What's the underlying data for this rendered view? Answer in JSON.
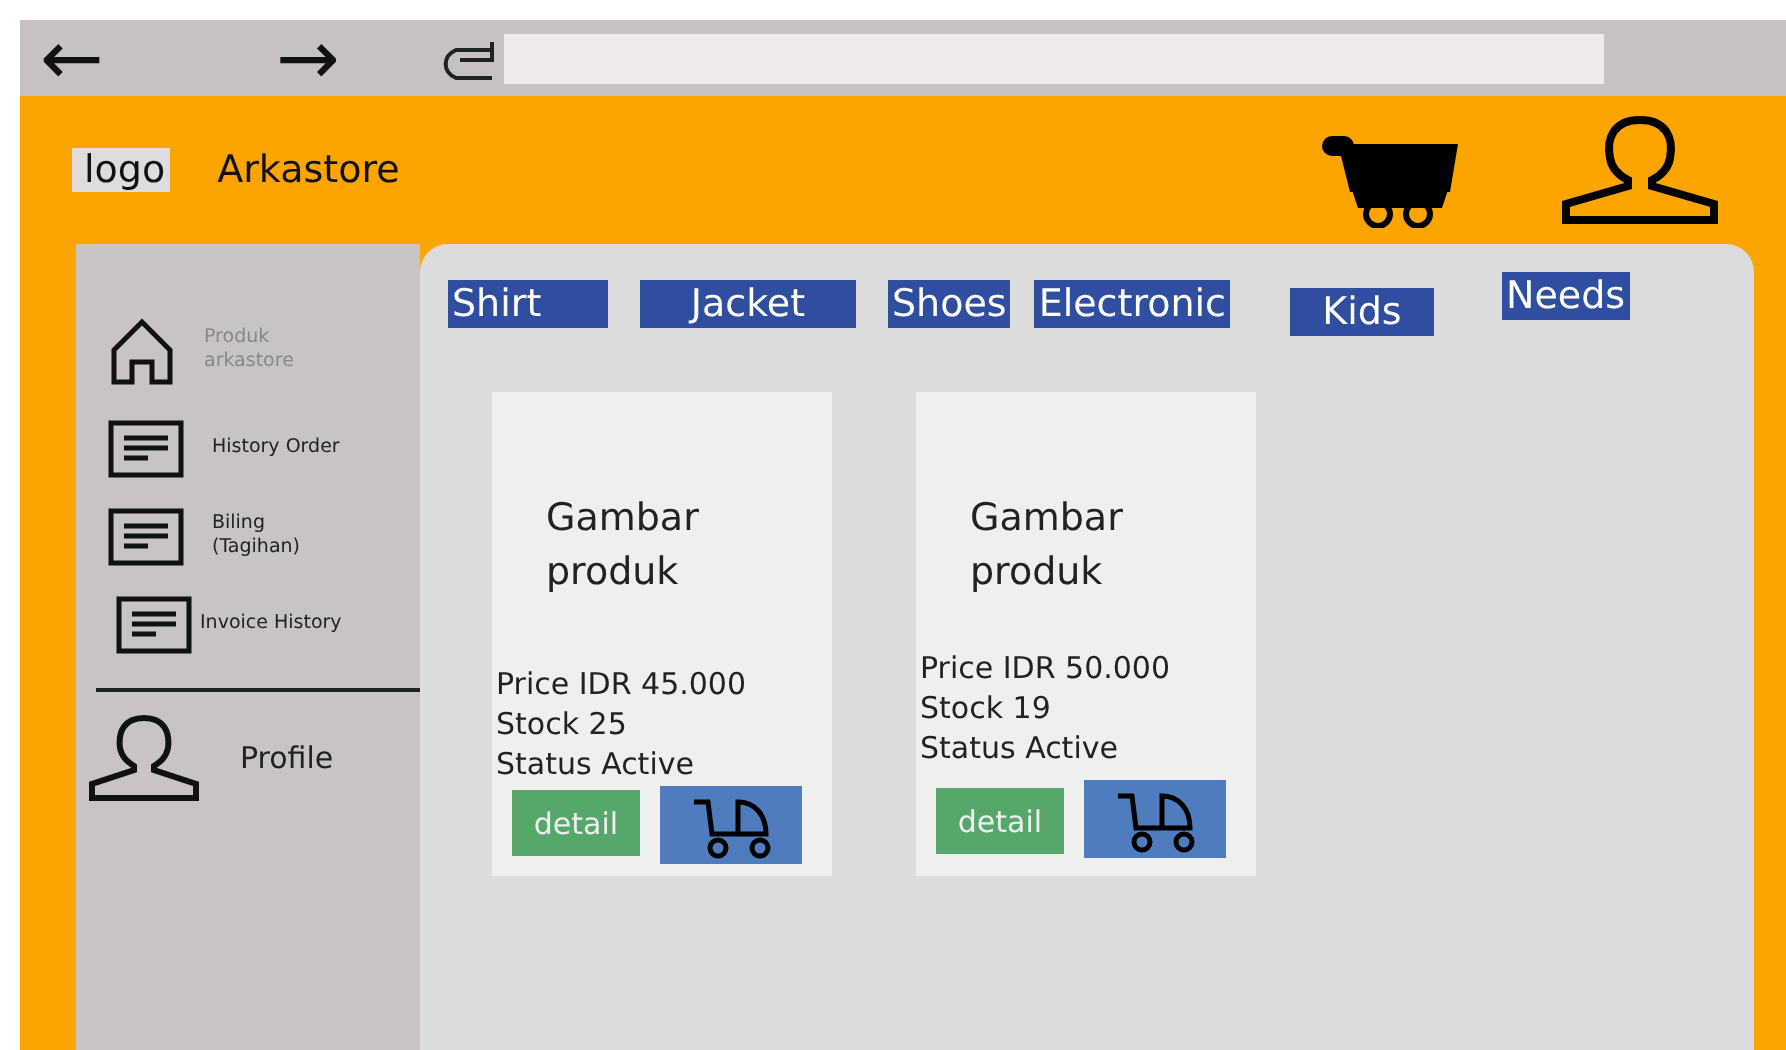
{
  "browser": {
    "back": "←",
    "forward": "→"
  },
  "header": {
    "logo": "logo",
    "brand": "Arkastore"
  },
  "sidebar": {
    "items": [
      {
        "label": "Produk arkastore",
        "selected": true
      },
      {
        "label": "History Order",
        "selected": false
      },
      {
        "label": "Biling (Tagihan)",
        "selected": false
      },
      {
        "label": "Invoice History",
        "selected": false
      }
    ],
    "profile": "Profile"
  },
  "categories": [
    "Shirt",
    "Jacket",
    "Shoes",
    "Electronic",
    "Kids",
    "Needs"
  ],
  "products": [
    {
      "image_text": "Gambar produk",
      "price": "Price IDR 45.000",
      "stock": "Stock 25",
      "status": "Status Active",
      "detail": "detail"
    },
    {
      "image_text": "Gambar produk",
      "price": "Price IDR 50.000",
      "stock": "Stock 19",
      "status": "Status Active",
      "detail": "detail"
    }
  ]
}
